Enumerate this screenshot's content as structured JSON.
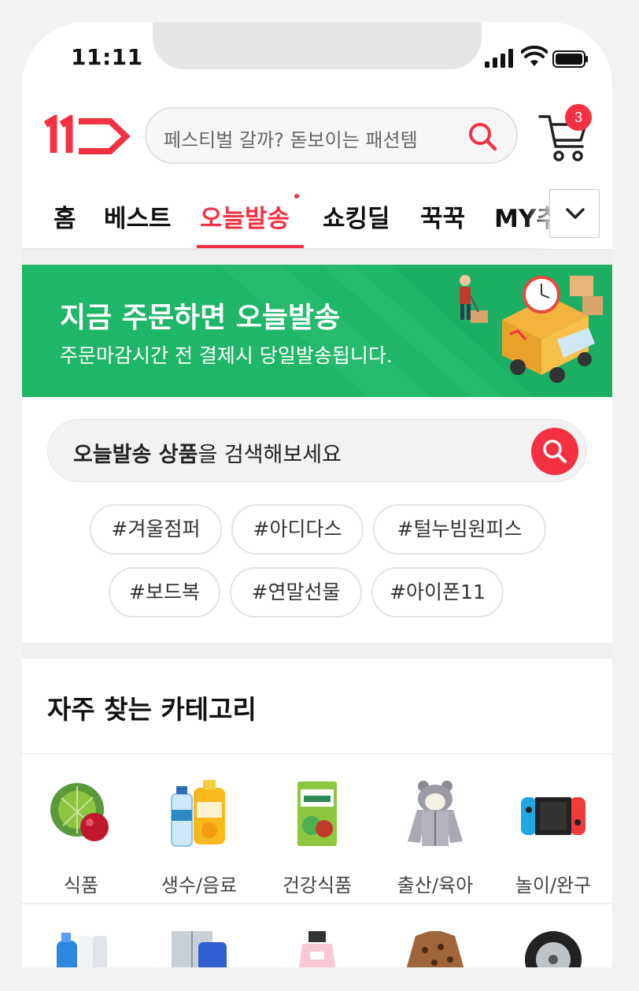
{
  "status": {
    "time": "11:11"
  },
  "header": {
    "search_placeholder": "페스티벌 갈까? 돋보이는 패션템",
    "cart_count": "3"
  },
  "tabs": [
    {
      "label": "홈"
    },
    {
      "label": "베스트"
    },
    {
      "label": "오늘발송",
      "active": true
    },
    {
      "label": "쇼킹딜"
    },
    {
      "label": "꾹꾹"
    },
    {
      "label": "MY추천"
    }
  ],
  "banner": {
    "title": "지금 주문하면 오늘발송",
    "subtitle": "주문마감시간 전 결제시 당일발송됩니다."
  },
  "today_search": {
    "bold_text": "오늘발송 상품",
    "rest_text": "을 검색해보세요"
  },
  "hashtags": [
    "#겨울점퍼",
    "#아디다스",
    "#털누빔원피스",
    "#보드복",
    "#연말선물",
    "#아이폰11"
  ],
  "categories": {
    "title": "자주 찾는 카테고리",
    "items": [
      {
        "label": "식품",
        "icon": "cabbage-icon"
      },
      {
        "label": "생수/음료",
        "icon": "water-bottle-icon"
      },
      {
        "label": "건강식품",
        "icon": "health-food-icon"
      },
      {
        "label": "출산/육아",
        "icon": "baby-jacket-icon"
      },
      {
        "label": "놀이/완구",
        "icon": "game-console-icon"
      }
    ]
  },
  "colors": {
    "accent": "#f43142",
    "banner": "#20b667"
  }
}
